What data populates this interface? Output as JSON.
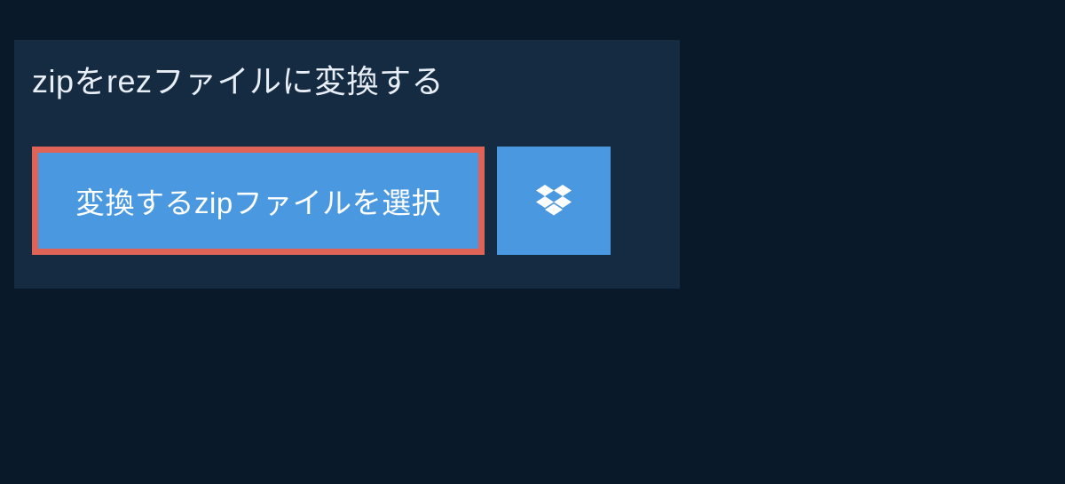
{
  "heading": "zipをrezファイルに変換する",
  "select_button_label": "変換するzipファイルを選択"
}
